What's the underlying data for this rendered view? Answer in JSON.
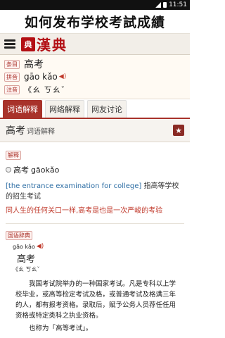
{
  "status": {
    "time": "11:51"
  },
  "banner": {
    "title": "如何发布学校考試成績"
  },
  "app": {
    "seal": "典",
    "logo": "漢典"
  },
  "header": {
    "entry_tag": "条目",
    "word": "高考",
    "pinyin_tag": "拼音",
    "pinyin": "gāo kǎo",
    "zhuyin_tag": "注音",
    "zhuyin": "《ㄠ ㄎㄠˇ"
  },
  "tabs": [
    {
      "label": "词语解释"
    },
    {
      "label": "网络解释"
    },
    {
      "label": "网友讨论"
    }
  ],
  "panel": {
    "title": "高考",
    "subtitle": "词语解释",
    "section_tag": "解释",
    "entry_word": "高考",
    "entry_pinyin": "gāokǎo",
    "en_text": "[the entrance examination for college]",
    "zh_def": " 指高等学校的招生考试",
    "example": "同人生的任何关口一样,高考是也是一次严峻的考验",
    "dict_tag": "国语辞典",
    "card_pinyin": "gāo kǎo",
    "card_word": "高考",
    "card_zhuyin": "《ㄠ ㄎㄠˇ",
    "card_para": "我国考试院举办的一种国家考试。凡是专科以上学校毕业，或高等检定考试及格，或普通考试及格满三年的人，都有报考资格。录取后，赋予公务人员荐任任用资格或特定类科之执业资格。",
    "card_para2": "也称为「高等考试」。"
  }
}
